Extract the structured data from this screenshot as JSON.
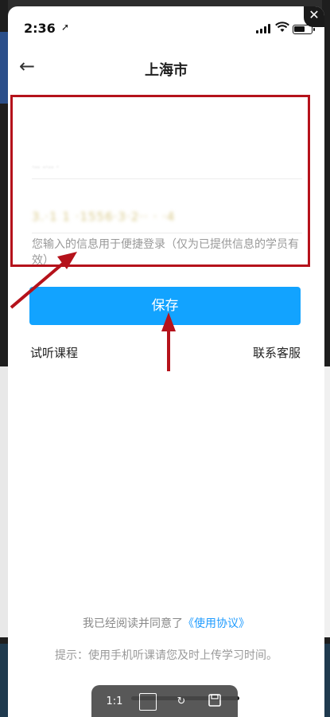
{
  "status_bar": {
    "time": "2:36",
    "location_glyph": "➚"
  },
  "nav": {
    "back_glyph": "←",
    "title": "上海市"
  },
  "form": {
    "field1_value": "·-- -·-- ·",
    "field2_value": "3.·1 1 ·1556·3·2·· · ·4",
    "hint": "您输入的信息用于便捷登录（仅为已提供信息的学员有效）"
  },
  "save_label": "保存",
  "links": {
    "trial": "试听课程",
    "contact": "联系客服"
  },
  "agreement": {
    "prefix": "我已经阅读并同意了",
    "link": "《使用协议》"
  },
  "tip": "提示：使用手机听课请您及时上传学习时间。",
  "viewer_toolbar": {
    "actual_size": "1:1",
    "fit": "▢",
    "rotate": "↻",
    "save": "▭"
  },
  "colors": {
    "accent": "#12a3ff",
    "annotation": "#b5121b"
  }
}
